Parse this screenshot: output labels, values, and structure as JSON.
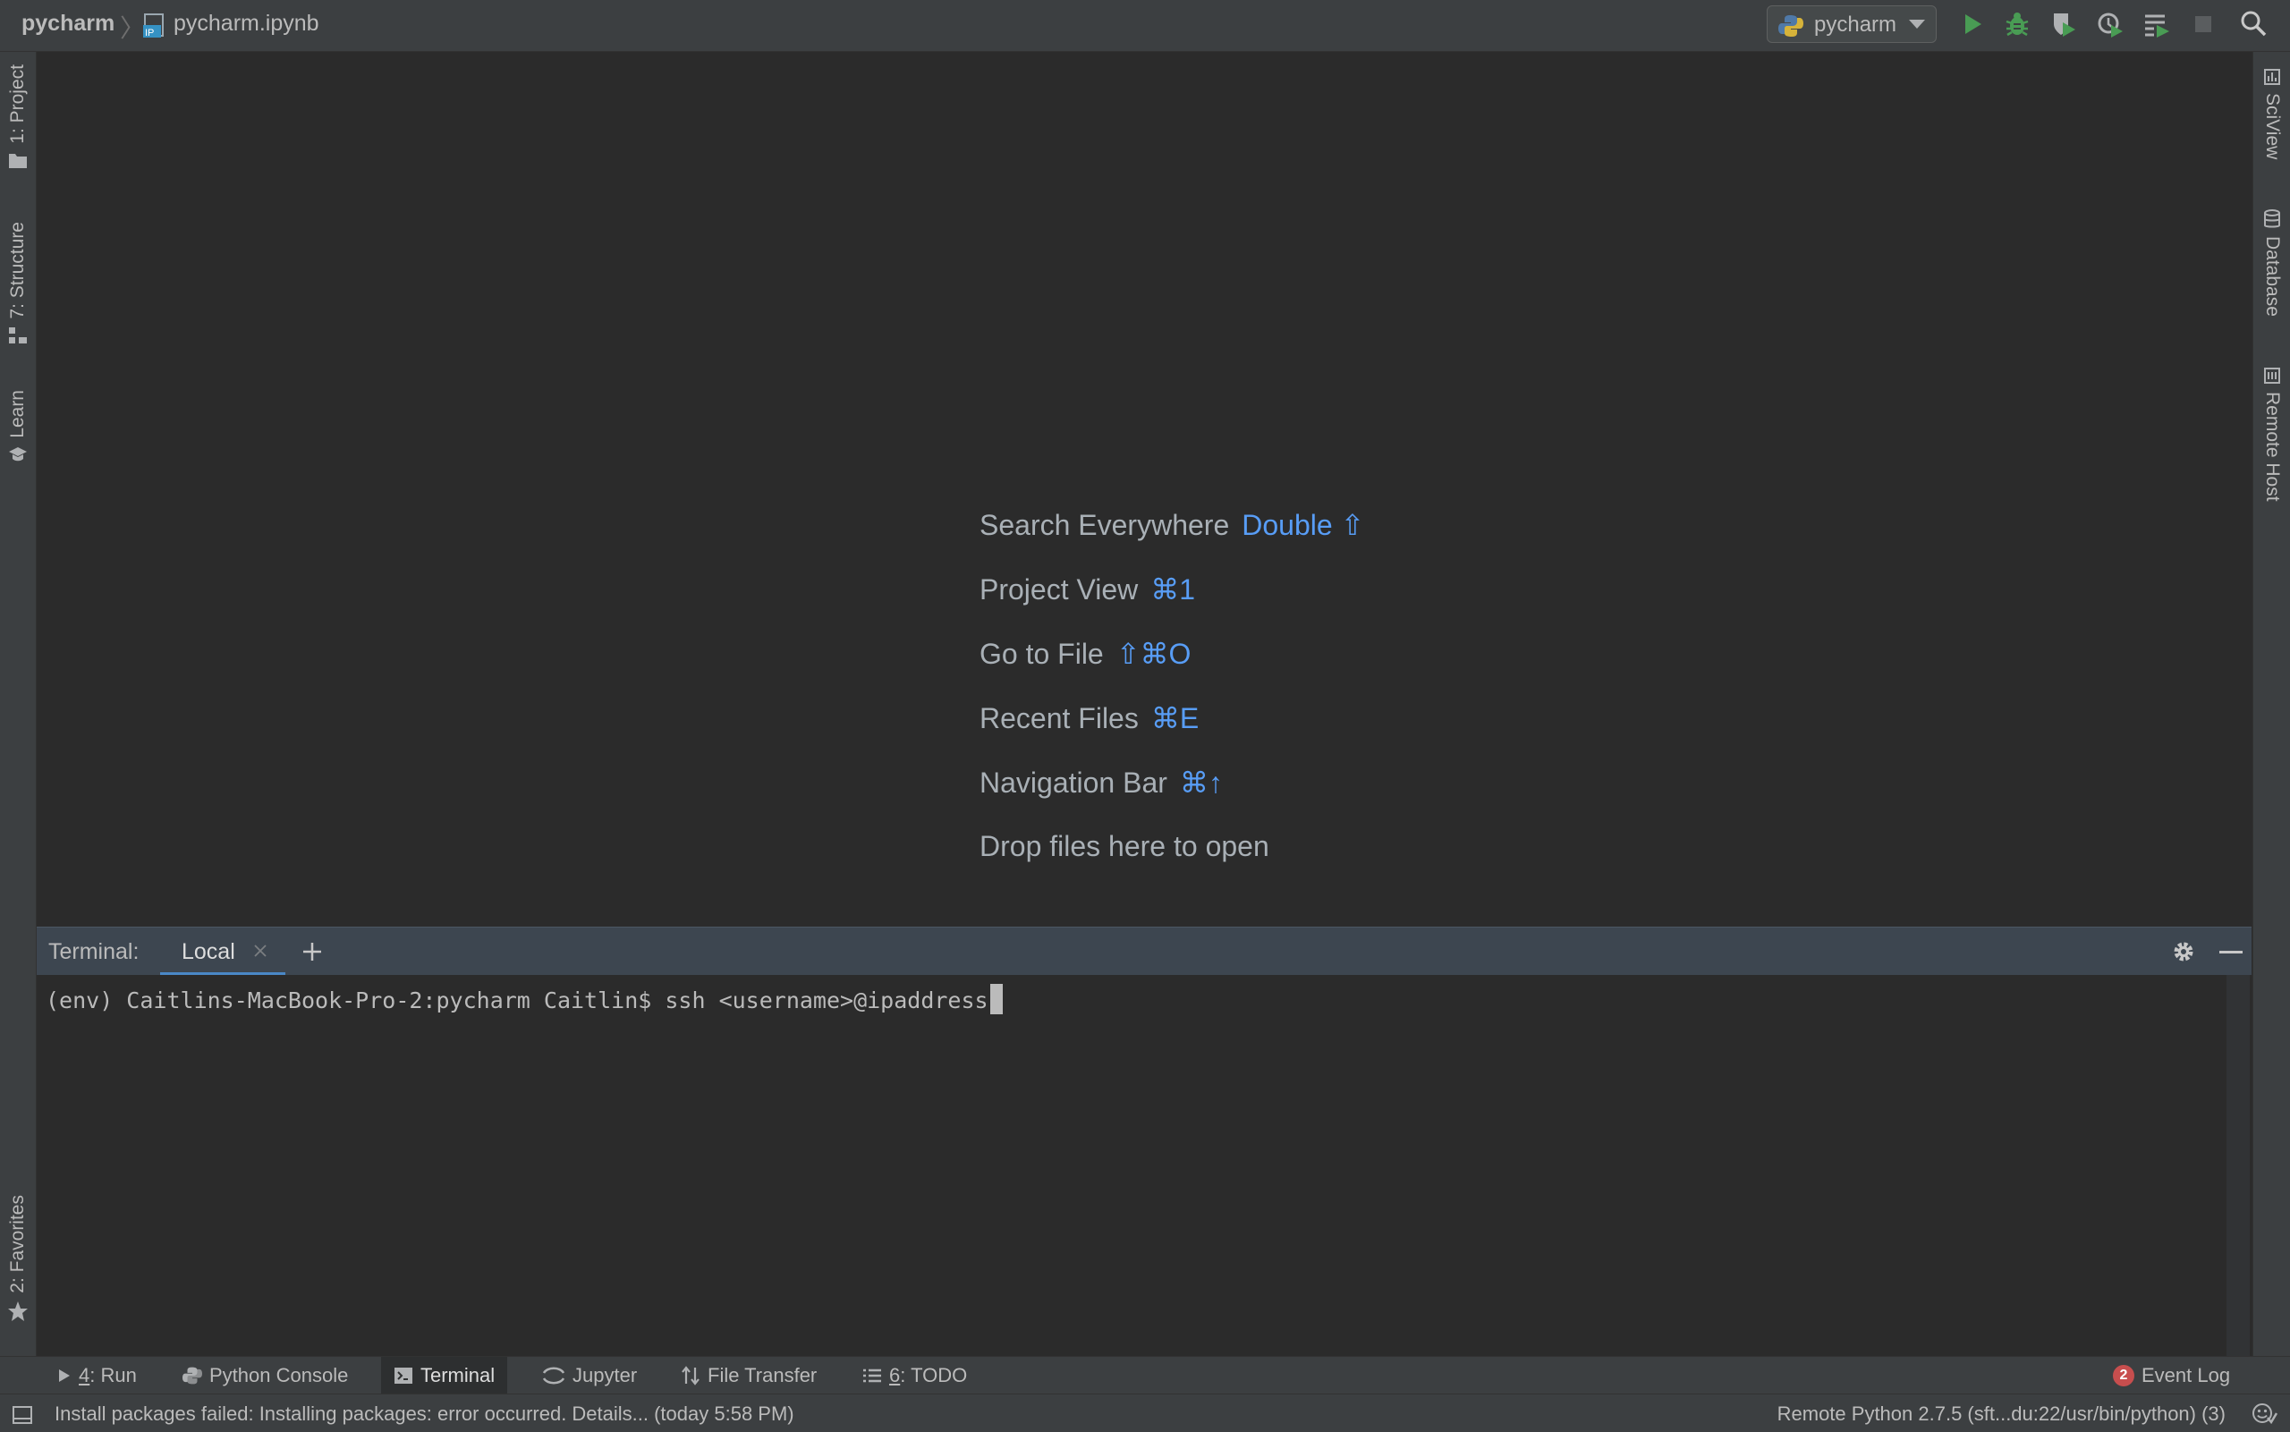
{
  "navbar": {
    "project": "pycharm",
    "file": "pycharm.ipynb",
    "file_icon_label": "IP",
    "run_config": "pycharm"
  },
  "left_tools": [
    {
      "label": "1: Project",
      "icon": "folder-icon"
    },
    {
      "label": "7: Structure",
      "icon": "structure-icon"
    },
    {
      "label": "Learn",
      "icon": "learn-icon"
    },
    {
      "label": "2: Favorites",
      "icon": "star-icon"
    }
  ],
  "right_tools": [
    {
      "label": "SciView",
      "icon": "sciview-icon"
    },
    {
      "label": "Database",
      "icon": "database-icon"
    },
    {
      "label": "Remote Host",
      "icon": "remote-host-icon"
    }
  ],
  "editor_hints": [
    {
      "label": "Search Everywhere",
      "shortcut": "Double ⇧"
    },
    {
      "label": "Project View",
      "shortcut": "⌘1"
    },
    {
      "label": "Go to File",
      "shortcut": "⇧⌘O"
    },
    {
      "label": "Recent Files",
      "shortcut": "⌘E"
    },
    {
      "label": "Navigation Bar",
      "shortcut": "⌘↑"
    },
    {
      "label": "Drop files here to open",
      "shortcut": ""
    }
  ],
  "terminal": {
    "title": "Terminal:",
    "tab": "Local",
    "line": "(env) Caitlins-MacBook-Pro-2:pycharm Caitlin$ ssh <username>@ipaddress"
  },
  "bottom_tools": [
    {
      "num": "4",
      "rest": ": Run",
      "label": "4: Run"
    },
    {
      "label": "Python Console"
    },
    {
      "label": "Terminal"
    },
    {
      "label": "Jupyter"
    },
    {
      "label": "File Transfer"
    },
    {
      "num": "6",
      "rest": ": TODO",
      "label": "6: TODO"
    }
  ],
  "event_log": {
    "count": "2",
    "label": "Event Log"
  },
  "status": {
    "message": "Install packages failed: Installing packages: error occurred. Details... (today 5:58 PM)",
    "interpreter": "Remote Python 2.7.5 (sft...du:22/usr/bin/python) (3)"
  },
  "colors": {
    "background": "#2b2b2b",
    "chrome": "#3c3f41",
    "accent_blue": "#589df6",
    "run_green": "#499c54",
    "error_red": "#c74e4e"
  }
}
